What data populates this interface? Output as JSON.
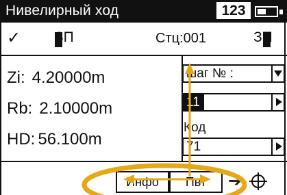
{
  "titlebar": {
    "title": "Нивелирный ход",
    "mode": "123"
  },
  "statusrow": {
    "check": "✓",
    "prev_point": "ЗП",
    "station": "Стц:001",
    "next_point": "ЗП"
  },
  "values": {
    "zi_label": "Zi:",
    "zi_value": "4.20000m",
    "rb_label": "Rb:",
    "rb_value": "2.10000m",
    "hd_label": "HD:",
    "hd_value": "56.100m"
  },
  "rightpanel": {
    "step_select": "шаг № :",
    "step_value": "11",
    "code_label": "Код",
    "code_value": "71"
  },
  "softkeys": {
    "info": "Инфо",
    "pos": "Пвт"
  },
  "icons": {
    "next": "arrow-right-icon",
    "target": "crosshair-icon"
  },
  "colors": {
    "overlay": "#e6a817",
    "display": "#111111",
    "background": "#ffffff"
  }
}
